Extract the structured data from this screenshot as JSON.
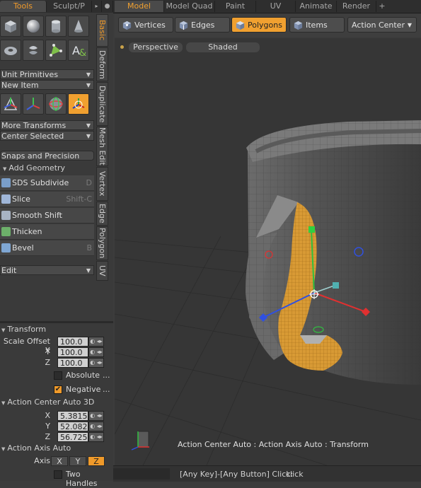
{
  "top_tabs": {
    "tools": "Tools",
    "sculpt": "Sculpt/P",
    "model": "Model",
    "model_quad": "Model Quad",
    "paint": "Paint",
    "uv": "UV",
    "animate": "Animate",
    "render": "Render",
    "add": "+"
  },
  "left_panel": {
    "unit_primitives": "Unit Primitives",
    "new_item": "New Item",
    "more_transforms": "More Transforms",
    "center_selected": "Center Selected",
    "snaps_precision": "Snaps and Precision",
    "add_geometry": "Add Geometry",
    "tools": [
      {
        "label": "SDS Subdivide",
        "key": "D"
      },
      {
        "label": "Slice",
        "key": "Shift-C"
      },
      {
        "label": "Smooth Shift",
        "key": ""
      },
      {
        "label": "Thicken",
        "key": ""
      },
      {
        "label": "Bevel",
        "key": "B"
      }
    ],
    "edit": "Edit"
  },
  "vertical_tabs": [
    "Basic",
    "Deform",
    "Duplicate",
    "Mesh Edit",
    "Vertex",
    "Edge",
    "Polygon",
    "UV"
  ],
  "properties": {
    "transform": "Transform",
    "scale_offset_label": "Scale Offset X",
    "y_label": "Y",
    "z_label": "Z",
    "scale_x": "100.0 %",
    "scale_y": "100.0 %",
    "scale_z": "100.0 %",
    "absolute": "Absolute",
    "negative": "Negative",
    "ellipsis": "...",
    "action_center": "Action Center Auto 3D",
    "x_label": "X",
    "ac_x": "5.3815",
    "ac_y": "52.082",
    "ac_z": "56.725",
    "action_axis": "Action Axis Auto",
    "axis_label": "Axis",
    "axis_x": "X",
    "axis_y": "Y",
    "axis_z": "Z",
    "two_handles": "Two Handles"
  },
  "viewport_toolbar": {
    "vertices": "Vertices",
    "edges": "Edges",
    "polygons": "Polygons",
    "items": "Items",
    "action_center": "Action Center"
  },
  "viewport": {
    "perspective": "Perspective",
    "shaded": "Shaded",
    "info": "Action Center Auto : Action Axis Auto : Transform"
  },
  "status": {
    "hint": "[Any Key]-[Any Button] Click:",
    "action": "click"
  },
  "colors": {
    "accent": "#f0a030",
    "gizmo_x": "#e03030",
    "gizmo_y": "#30c040",
    "gizmo_z": "#3050e0"
  }
}
